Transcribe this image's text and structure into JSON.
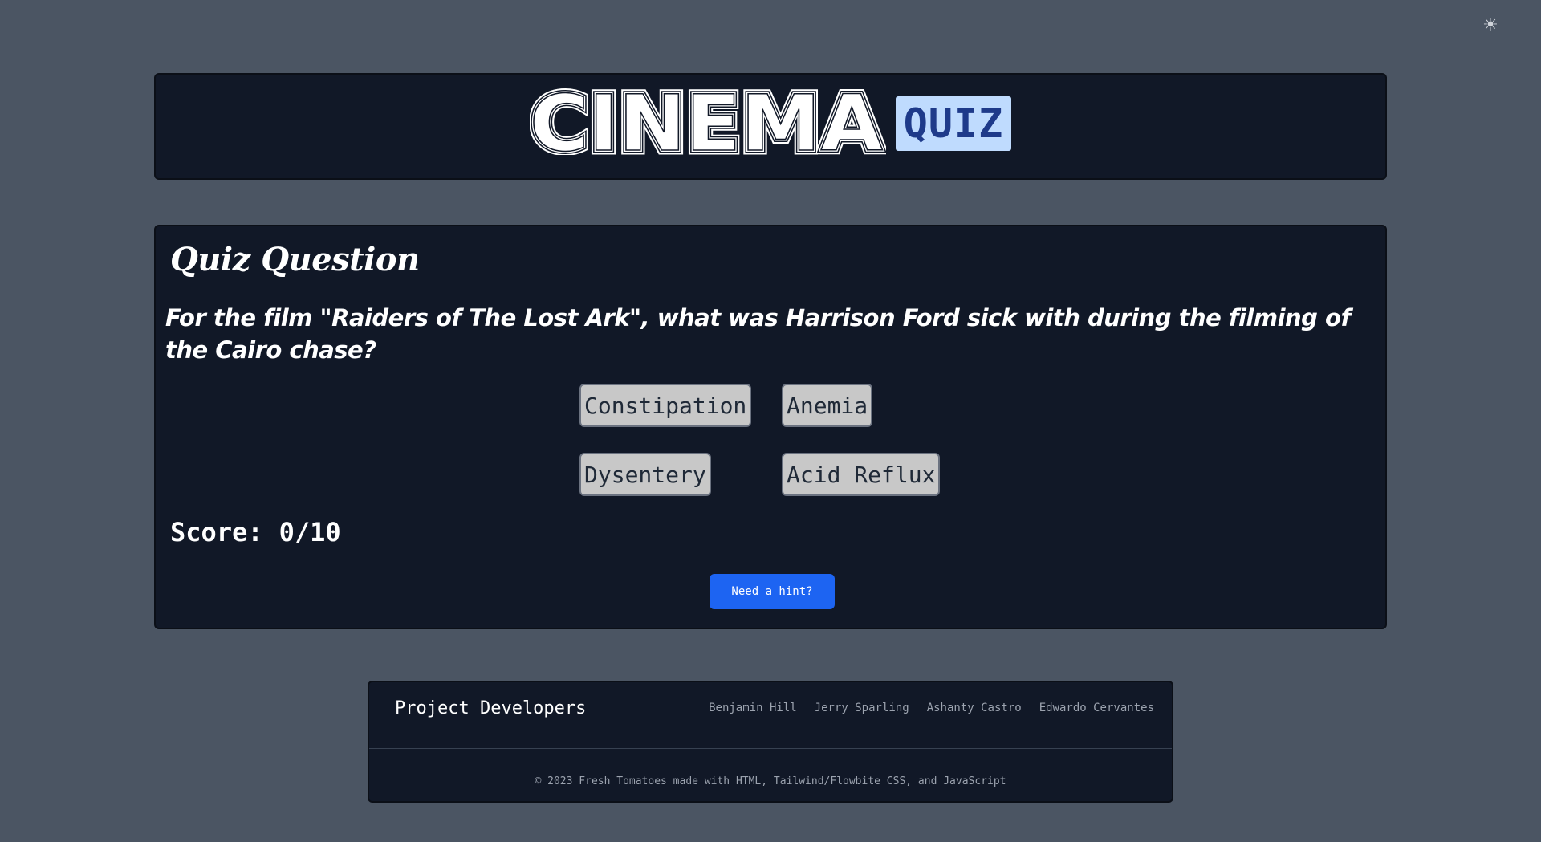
{
  "theme_toggle": {
    "icon": "sun-icon",
    "glyph": "☀"
  },
  "header": {
    "logo_text": "CINEMA",
    "badge": "QUIZ"
  },
  "quiz": {
    "title": "Quiz Question",
    "question": "For the film \"Raiders of The Lost Ark\", what was Harrison Ford sick with during the filming of the Cairo chase?",
    "answers": [
      "Constipation",
      "Anemia",
      "Dysentery",
      "Acid Reflux"
    ],
    "score_label": "Score:",
    "score_value": "0/10",
    "hint_label": "Need a hint?"
  },
  "footer": {
    "title": "Project Developers",
    "developers": [
      "Benjamin Hill",
      "Jerry Sparling",
      "Ashanty Castro",
      "Edwardo Cervantes"
    ],
    "copyright": "© 2023 Fresh Tomatoes made with HTML, Tailwind/Flowbite CSS, and JavaScript"
  },
  "colors": {
    "background": "#4b5563",
    "panel": "#111827",
    "badge_bg": "#bfdbfe",
    "badge_text": "#1e3a8a",
    "hint_button": "#1d64f2",
    "answer_bg": "#c8c8c8"
  }
}
